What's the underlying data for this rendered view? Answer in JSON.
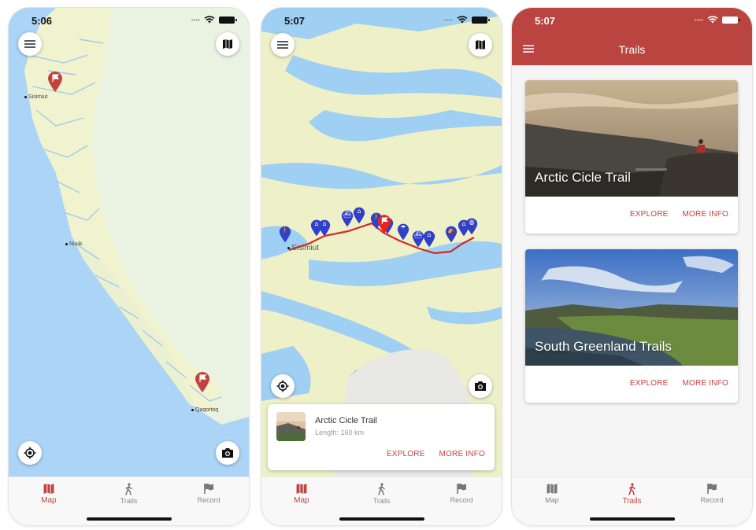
{
  "screens": [
    {
      "status": {
        "time": "5:06"
      },
      "map": {
        "labels": [
          "Sisimiut",
          "Nuuk",
          "Qaqortoq"
        ],
        "pins": [
          {
            "name": "arctic-circle-trail-pin",
            "icon": "flag-icon",
            "color": "#c0433f"
          },
          {
            "name": "south-greenland-pin",
            "icon": "flag-icon",
            "color": "#c0433f"
          }
        ]
      },
      "buttons": {
        "menu": "menu-icon",
        "layers": "map-icon",
        "locate": "locate-icon",
        "camera": "camera-icon"
      },
      "tabs": [
        {
          "label": "Map",
          "active": true
        },
        {
          "label": "Trails",
          "active": false
        },
        {
          "label": "Record",
          "active": false
        }
      ]
    },
    {
      "status": {
        "time": "5:07"
      },
      "map": {
        "labels": [
          "Sisimiut"
        ],
        "route_color": "#d12a2a",
        "poi_color": "#3140c8",
        "poi_icons": [
          "hiker-icon",
          "hut-icon",
          "hut-icon",
          "boat-icon",
          "hut-icon",
          "hiker-icon",
          "hut-icon",
          "shelter-icon",
          "boat-icon",
          "hut-icon",
          "tent-icon",
          "hut-icon",
          "globe-icon"
        ]
      },
      "info_card": {
        "title": "Arctic Cicle Trail",
        "subtitle": "Length: 160 km",
        "explore": "EXPLORE",
        "more_info": "MORE INFO"
      },
      "tabs": [
        {
          "label": "Map",
          "active": true
        },
        {
          "label": "Trails",
          "active": false
        },
        {
          "label": "Record",
          "active": false
        }
      ]
    },
    {
      "status": {
        "time": "5:07"
      },
      "appbar": {
        "title": "Trails",
        "color": "#b94440"
      },
      "cards": [
        {
          "title": "Arctic Cicle Trail",
          "explore": "EXPLORE",
          "more_info": "MORE INFO"
        },
        {
          "title": "South Greenland Trails",
          "explore": "EXPLORE",
          "more_info": "MORE INFO"
        }
      ],
      "tabs": [
        {
          "label": "Map",
          "active": false
        },
        {
          "label": "Trails",
          "active": true
        },
        {
          "label": "Record",
          "active": false
        }
      ]
    }
  ],
  "colors": {
    "accent": "#c0433f",
    "inactive": "#8a8a8a",
    "water": "#acd3f5",
    "land": "#eef2dc"
  }
}
